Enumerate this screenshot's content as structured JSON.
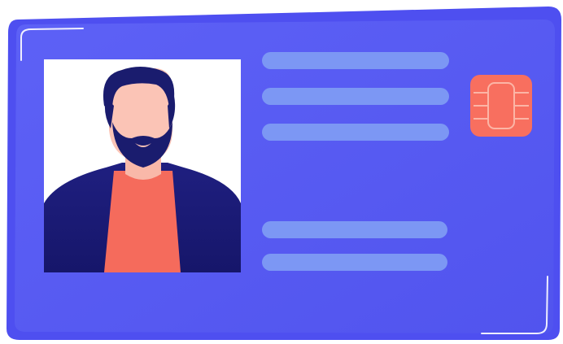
{
  "illustration": {
    "subject": "id-card",
    "icons": {
      "portrait": "person-avatar-icon",
      "chip": "smart-chip-icon"
    },
    "colors": {
      "card_back": "#4f4ff2",
      "card_front": "#5b5ef5",
      "text_line": "#7b96f4",
      "chip": "#f87060",
      "chip_stroke": "#fbb7a6",
      "photo_bg": "#ffffff",
      "hair_beard": "#1a1c6e",
      "skin": "#fbc3b5",
      "shirt": "#f76b5c",
      "jacket": "#1b1b78",
      "highlight": "#ffffff"
    },
    "text_lines_count": 5
  }
}
